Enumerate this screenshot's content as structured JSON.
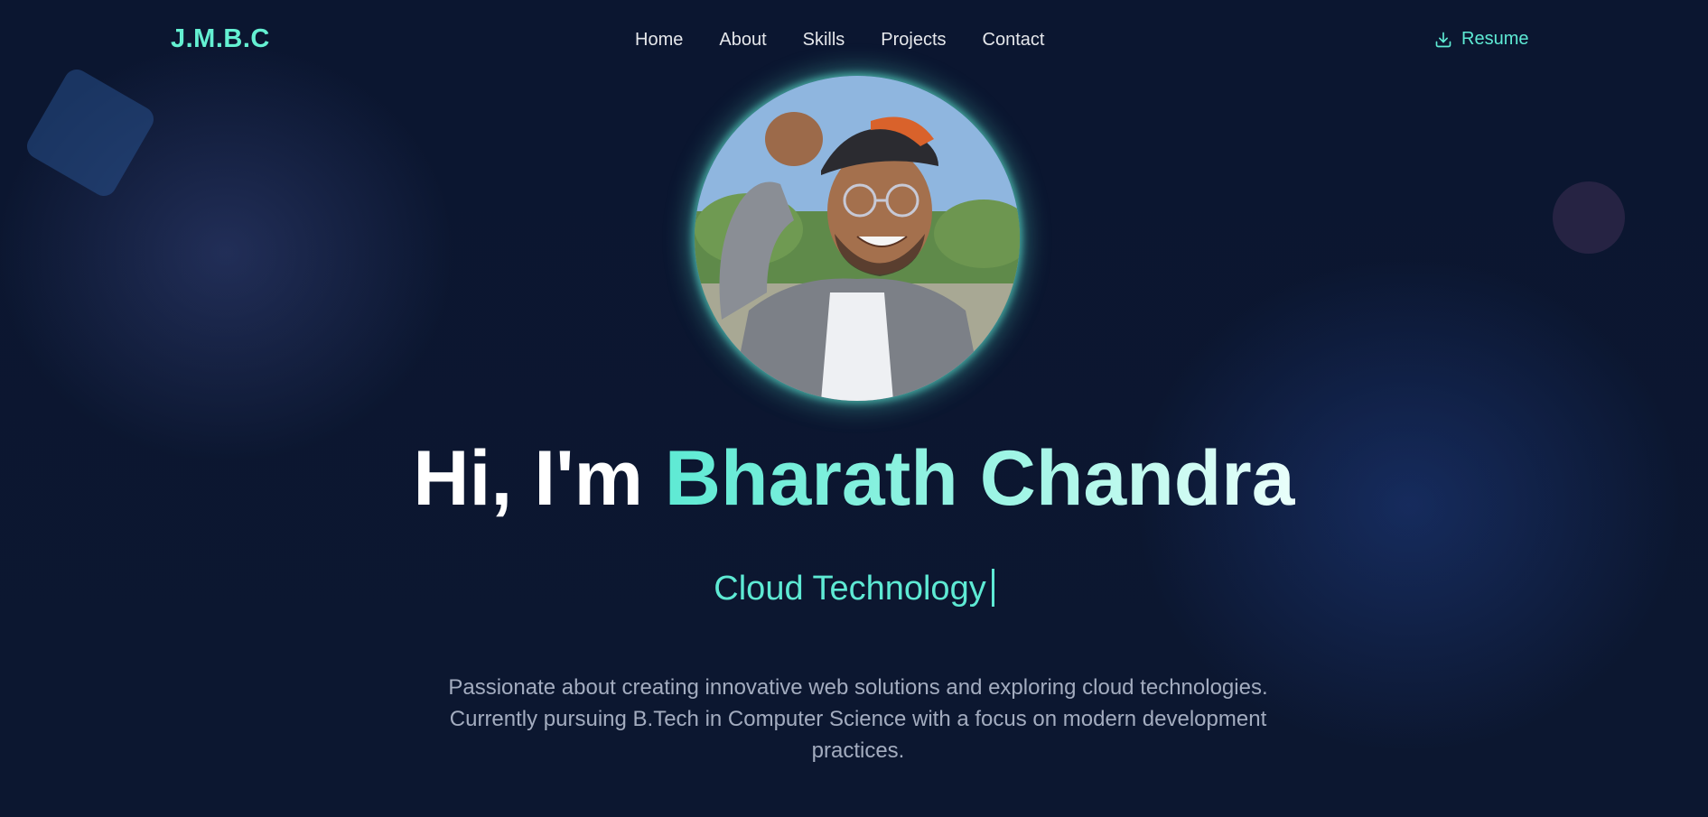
{
  "nav": {
    "logo": "J.M.B.C",
    "links": [
      "Home",
      "About",
      "Skills",
      "Projects",
      "Contact"
    ],
    "resume_label": "Resume",
    "resume_icon": "download-icon"
  },
  "hero": {
    "avatar_alt": "profile-photo",
    "greeting_prefix": "Hi, I'm ",
    "name": "Bharath Chandra",
    "role": "Cloud Technology",
    "bio": "Passionate about creating innovative web solutions and exploring cloud technologies. Currently pursuing B.Tech in Computer Science with a focus on modern development practices."
  },
  "colors": {
    "background": "#0c1730",
    "accent": "#5eead4",
    "text": "#e5e7eb",
    "muted": "#a3acbf"
  }
}
